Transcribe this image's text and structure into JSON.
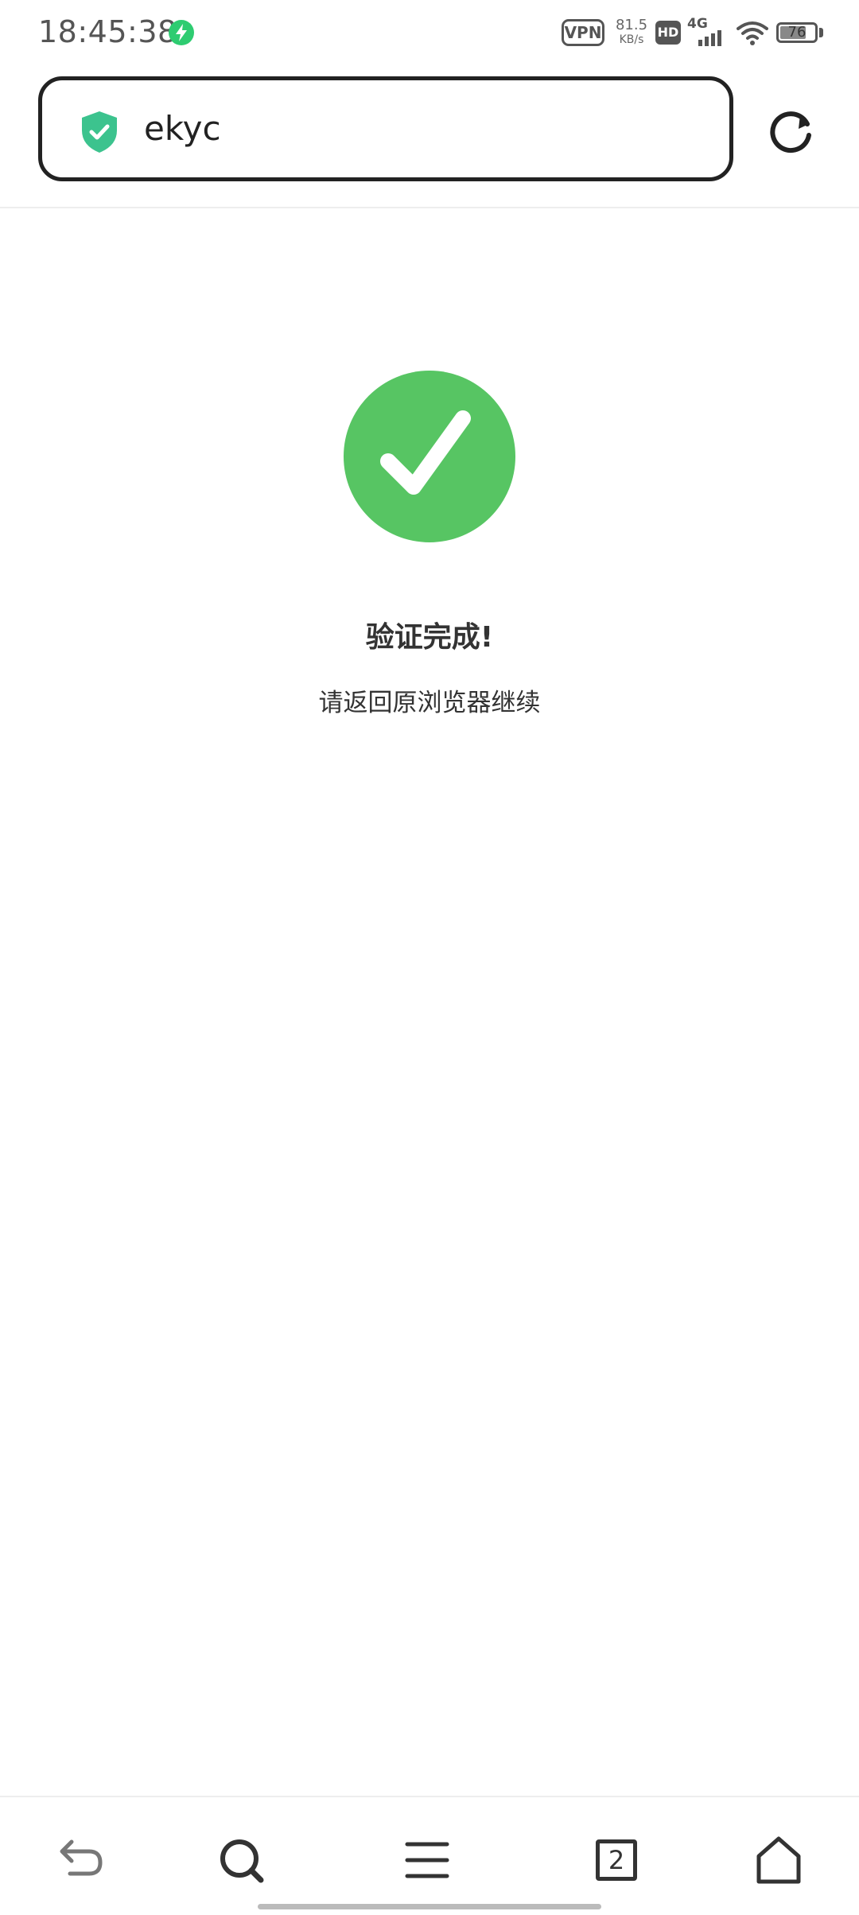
{
  "status_bar": {
    "time": "18:45:38",
    "vpn_label": "VPN",
    "net_speed_value": "81.5",
    "net_speed_unit": "KB/s",
    "hd_label": "HD",
    "signal_label": "4G",
    "battery_level": "76",
    "battery_fraction": 0.76
  },
  "address_bar": {
    "url": "ekyc"
  },
  "main": {
    "title": "验证完成!",
    "subtitle": "请返回原浏览器继续"
  },
  "bottom_nav": {
    "tab_count": "2"
  },
  "colors": {
    "success": "#57c563",
    "shield": "#3cc38e",
    "text": "#333333"
  },
  "icons": {
    "charging": "lightning-bolt-icon",
    "shield": "shield-check-icon",
    "refresh": "refresh-icon",
    "success": "checkmark-icon",
    "back": "back-arrow-icon",
    "search": "search-icon",
    "menu": "hamburger-menu-icon",
    "tabs": "tabs-icon",
    "home": "home-icon"
  }
}
